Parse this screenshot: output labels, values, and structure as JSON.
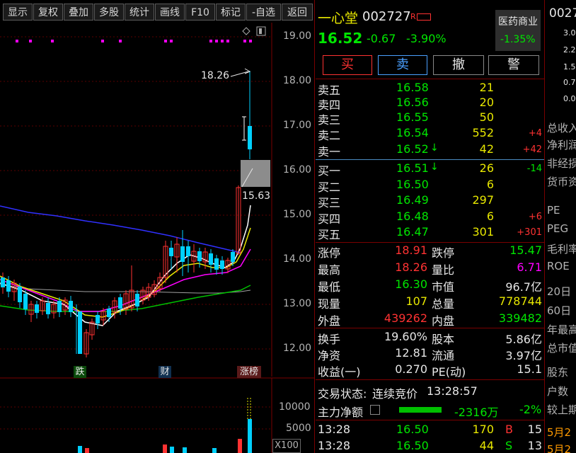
{
  "toolbar": {
    "items": [
      "显示",
      "复权",
      "叠加",
      "多股",
      "统计",
      "画线",
      "F10",
      "标记",
      "-自选",
      "返回"
    ]
  },
  "chart": {
    "price_axis": [
      "19.00",
      "18.00",
      "17.00",
      "16.00",
      "15.00",
      "14.00",
      "13.00",
      "12.00"
    ],
    "high_label": "18.26",
    "low_label": "15.63",
    "markers": {
      "die": "跌",
      "cai": "财",
      "zhangbang": "涨榜"
    },
    "volume_axis": [
      "10000",
      "5000"
    ],
    "volume_unit": "X100"
  },
  "quote": {
    "name": "一心堂",
    "code": "002727",
    "r_badge": "R",
    "price": "16.52",
    "change": "-0.67",
    "change_pct": "-3.90%",
    "sector_name": "医药商业",
    "sector_pct": "-1.35%"
  },
  "actions": {
    "buy": "买",
    "sell": "卖",
    "cancel": "撤",
    "alert": "警"
  },
  "asks": [
    {
      "label": "卖五",
      "price": "16.58",
      "vol": "21",
      "chg": "",
      "arrow": ""
    },
    {
      "label": "卖四",
      "price": "16.56",
      "vol": "20",
      "chg": "",
      "arrow": ""
    },
    {
      "label": "卖三",
      "price": "16.55",
      "vol": "50",
      "chg": "",
      "arrow": ""
    },
    {
      "label": "卖二",
      "price": "16.54",
      "vol": "552",
      "chg": "+4",
      "arrow": ""
    },
    {
      "label": "卖一",
      "price": "16.52",
      "vol": "42",
      "chg": "+42",
      "arrow": "↓"
    }
  ],
  "bids": [
    {
      "label": "买一",
      "price": "16.51",
      "vol": "26",
      "chg": "-14",
      "arrow": "↓"
    },
    {
      "label": "买二",
      "price": "16.50",
      "vol": "6",
      "chg": "",
      "arrow": ""
    },
    {
      "label": "买三",
      "price": "16.49",
      "vol": "297",
      "chg": "",
      "arrow": ""
    },
    {
      "label": "买四",
      "price": "16.48",
      "vol": "6",
      "chg": "+6",
      "arrow": ""
    },
    {
      "label": "买五",
      "price": "16.47",
      "vol": "301",
      "chg": "+301",
      "arrow": ""
    }
  ],
  "stats": {
    "zhangting_label": "涨停",
    "zhangting": "18.91",
    "dieting_label": "跌停",
    "dieting": "15.47",
    "zuigao_label": "最高",
    "zuigao": "18.26",
    "liangbi_label": "量比",
    "liangbi": "6.71",
    "zuidi_label": "最低",
    "zuidi": "16.30",
    "shizhi_label": "市值",
    "shizhi": "96.7亿",
    "xianliang_label": "现量",
    "xianliang": "107",
    "zongliang_label": "总量",
    "zongliang": "778744",
    "waipan_label": "外盘",
    "waipan": "439262",
    "neipan_label": "内盘",
    "neipan": "339482",
    "huanshou_label": "换手",
    "huanshou": "19.60%",
    "guben_label": "股本",
    "guben": "5.86亿",
    "jingzi_label": "净资",
    "jingzi": "12.81",
    "liutong_label": "流通",
    "liutong": "3.97亿",
    "shouyi_label": "收益(一)",
    "shouyi": "0.270",
    "pe_label": "PE(动)",
    "pe": "15.1"
  },
  "trade_status": {
    "label": "交易状态:",
    "value": "连续竞价",
    "time": "13:28:57"
  },
  "main_net": {
    "label": "主力净额",
    "value": "-2316万",
    "pct": "-2%"
  },
  "ticks": [
    {
      "time": "13:28",
      "price": "16.50",
      "vol": "170",
      "side": "B",
      "n": "15"
    },
    {
      "time": "13:28",
      "price": "16.50",
      "vol": "44",
      "side": "S",
      "n": "13"
    }
  ],
  "far": {
    "code": "0027",
    "nums": [
      "3.0",
      "2.2",
      "1.5",
      "0.7",
      "0.0"
    ],
    "labels": [
      "总收入",
      "净利润",
      "非经损",
      "货币资",
      "PE",
      "PEG",
      "毛利率",
      "ROE",
      "20日",
      "60日",
      "年最高",
      "总市值",
      "股东",
      "户数",
      "较上期",
      "5月2",
      "5月2"
    ]
  },
  "colors": {
    "up": "#ff3232",
    "down": "#00e600",
    "ma5": "#ffffff",
    "ma10": "#e8e800",
    "ma20": "#ff00ff",
    "ma60": "#3030ff"
  }
}
